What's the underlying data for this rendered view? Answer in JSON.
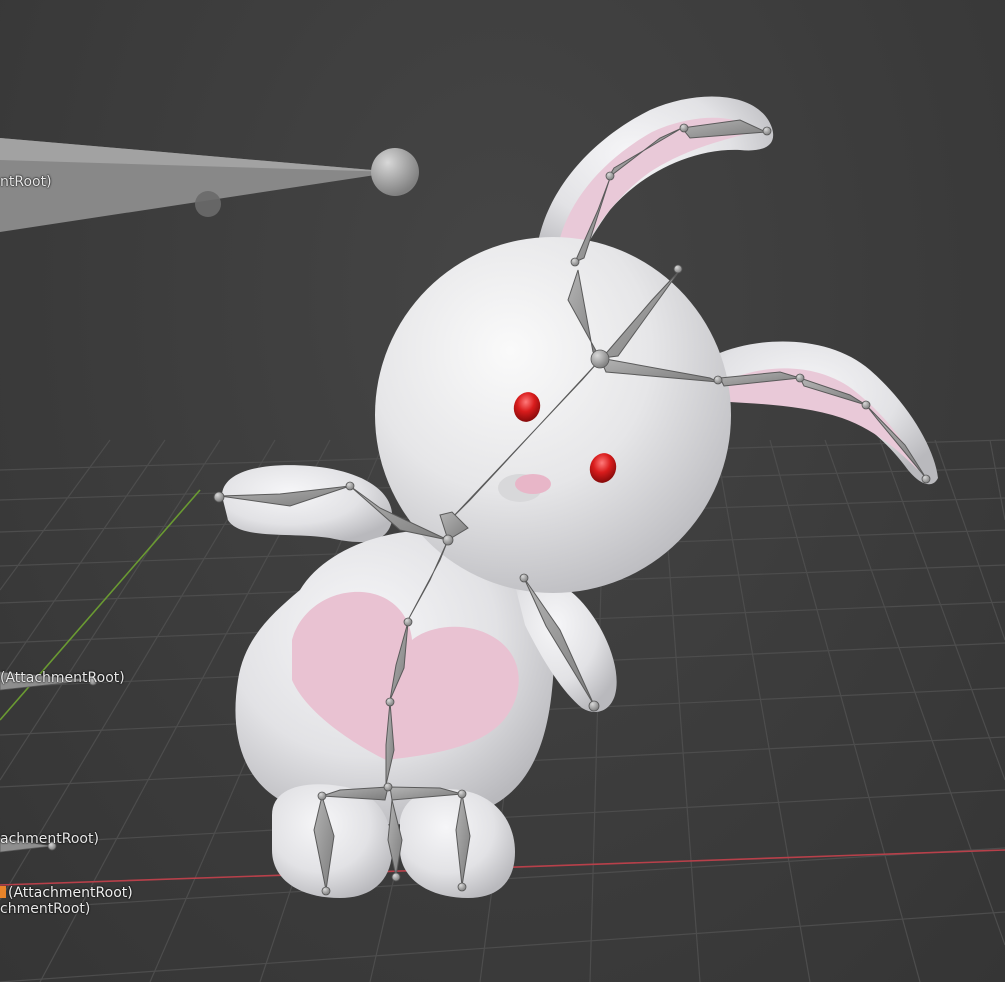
{
  "viewport": {
    "background": "#3d3d3d",
    "grid_color": "#4a4a4a",
    "x_axis_color": "#b8404a",
    "y_axis_color": "#6a9a32"
  },
  "labels": {
    "label_1": "ntRoot)",
    "label_2": "(AttachmentRoot)",
    "label_3": "achmentRoot)",
    "label_4": "(AttachmentRoot)",
    "label_5": "chmentRoot)"
  },
  "model": {
    "body_color": "#e4e4e6",
    "ear_inner_color": "#e6c6d6",
    "heart_color": "#e8c0d0",
    "eye_color": "#d02020",
    "bone_color": "#9a9a9a",
    "selection_accent": "#e8842a"
  }
}
